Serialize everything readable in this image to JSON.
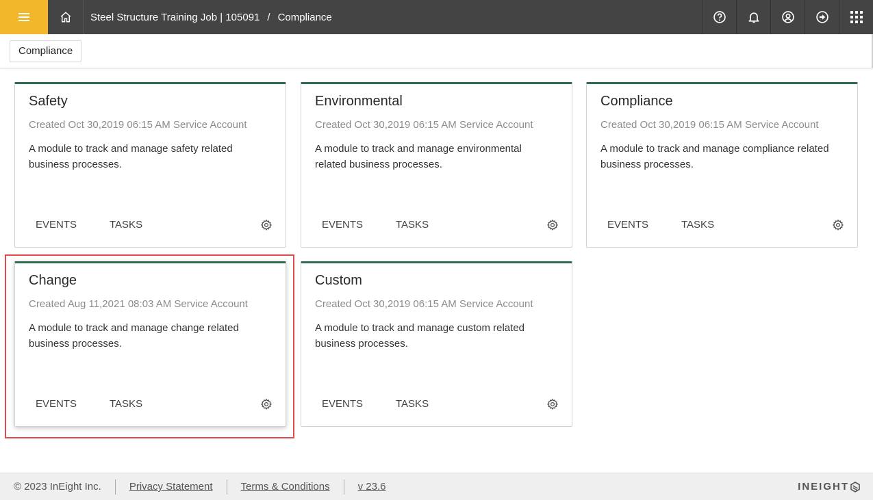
{
  "header": {
    "breadcrumb": {
      "project": "Steel Structure Training Job | 105091",
      "separator": "/",
      "current": "Compliance"
    },
    "icons": [
      "menu-icon",
      "home-icon",
      "help-icon",
      "bell-icon",
      "user-icon",
      "logout-icon",
      "apps-grid-icon"
    ],
    "accent_color": "#f2b72b",
    "bar_color": "#444444"
  },
  "subheader": {
    "tab_label": "Compliance"
  },
  "cards": [
    {
      "title": "Safety",
      "meta": "Created Oct 30,2019 06:15 AM Service Account",
      "description": "A module to track and manage safety related business processes.",
      "events": "EVENTS",
      "tasks": "TASKS"
    },
    {
      "title": "Environmental",
      "meta": "Created Oct 30,2019 06:15 AM Service Account",
      "description": "A module to track and manage environmental related business processes.",
      "events": "EVENTS",
      "tasks": "TASKS"
    },
    {
      "title": "Compliance",
      "meta": "Created Oct 30,2019 06:15 AM Service Account",
      "description": "A module to track and manage compliance related business processes.",
      "events": "EVENTS",
      "tasks": "TASKS"
    },
    {
      "title": "Change",
      "meta": "Created Aug 11,2021 08:03 AM Service Account",
      "description": "A module to track and manage change related business processes.",
      "events": "EVENTS",
      "tasks": "TASKS"
    },
    {
      "title": "Custom",
      "meta": "Created Oct 30,2019 06:15 AM Service Account",
      "description": "A module to track and manage custom related business processes.",
      "events": "EVENTS",
      "tasks": "TASKS"
    }
  ],
  "card_accent_color": "#2e6b4f",
  "highlight_color": "#e04a4a",
  "footer": {
    "copyright": "© 2023 InEight Inc.",
    "privacy": "Privacy Statement",
    "terms": "Terms & Conditions",
    "version": "v 23.6",
    "brand": "INEIGHT"
  }
}
